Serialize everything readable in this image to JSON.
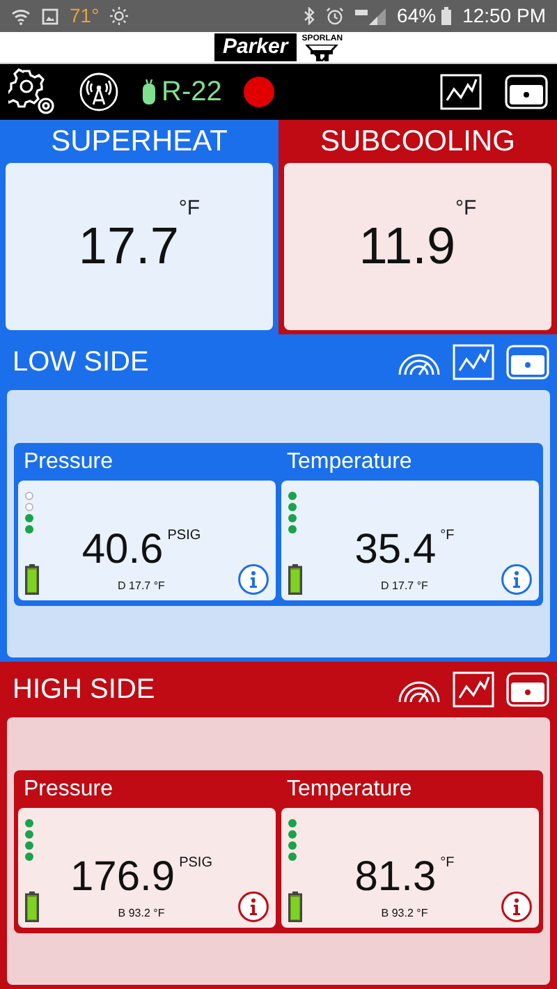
{
  "status_bar": {
    "temperature": "71°",
    "battery": "64%",
    "time": "12:50 PM"
  },
  "brand": {
    "logo_left": "Parker",
    "logo_right": "SPORLAN"
  },
  "toolbar": {
    "refrigerant": "R-22",
    "recording": true
  },
  "summary": [
    {
      "kind": "low",
      "title": "SUPERHEAT",
      "value": "17.7",
      "unit": "°F"
    },
    {
      "kind": "high",
      "title": "SUBCOOLING",
      "value": "11.9",
      "unit": "°F"
    }
  ],
  "sections": [
    {
      "kind": "low",
      "title": "LOW SIDE",
      "sensors": [
        {
          "label": "Pressure",
          "value": "40.6",
          "unit": "PSIG",
          "footer": "D 17.7 °F",
          "signal": [
            {
              "on": false
            },
            {
              "on": false
            },
            {
              "on": true
            },
            {
              "on": true
            }
          ]
        },
        {
          "label": "Temperature",
          "value": "35.4",
          "unit": "°F",
          "footer": "D 17.7 °F",
          "signal": [
            {
              "on": true
            },
            {
              "on": true
            },
            {
              "on": true
            },
            {
              "on": true
            }
          ]
        }
      ]
    },
    {
      "kind": "high",
      "title": "HIGH SIDE",
      "sensors": [
        {
          "label": "Pressure",
          "value": "176.9",
          "unit": "PSIG",
          "footer": "B 93.2 °F",
          "signal": [
            {
              "on": true
            },
            {
              "on": true
            },
            {
              "on": true
            },
            {
              "on": true
            }
          ]
        },
        {
          "label": "Temperature",
          "value": "81.3",
          "unit": "°F",
          "footer": "B 93.2 °F",
          "signal": [
            {
              "on": true
            },
            {
              "on": true
            },
            {
              "on": true
            },
            {
              "on": true
            }
          ]
        }
      ]
    }
  ]
}
